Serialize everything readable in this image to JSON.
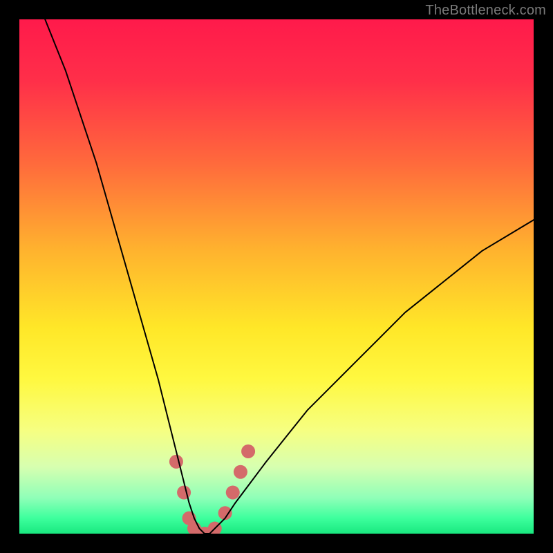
{
  "watermark": "TheBottleneck.com",
  "chart_data": {
    "type": "line",
    "title": "",
    "xlabel": "",
    "ylabel": "",
    "xlim": [
      0,
      100
    ],
    "ylim": [
      0,
      100
    ],
    "grid": false,
    "legend": false,
    "gradient_stops": [
      {
        "offset": 0.0,
        "color": "#ff1a4b"
      },
      {
        "offset": 0.12,
        "color": "#ff2f49"
      },
      {
        "offset": 0.28,
        "color": "#ff6a3c"
      },
      {
        "offset": 0.45,
        "color": "#ffb32e"
      },
      {
        "offset": 0.6,
        "color": "#ffe728"
      },
      {
        "offset": 0.7,
        "color": "#fff840"
      },
      {
        "offset": 0.8,
        "color": "#f6ff82"
      },
      {
        "offset": 0.87,
        "color": "#d7ffb0"
      },
      {
        "offset": 0.93,
        "color": "#90ffb8"
      },
      {
        "offset": 0.97,
        "color": "#3dff9d"
      },
      {
        "offset": 1.0,
        "color": "#19e87f"
      }
    ],
    "series": [
      {
        "name": "bottleneck-curve",
        "stroke": "#000000",
        "stroke_width": 2,
        "x": [
          5,
          7,
          9,
          11,
          13,
          15,
          17,
          19,
          21,
          23,
          25,
          27,
          29,
          30,
          31,
          32,
          33,
          34,
          35,
          36,
          37,
          38,
          40,
          42,
          45,
          48,
          52,
          56,
          60,
          65,
          70,
          75,
          80,
          85,
          90,
          95,
          100
        ],
        "y": [
          100,
          95,
          90,
          84,
          78,
          72,
          65,
          58,
          51,
          44,
          37,
          30,
          22,
          18,
          14,
          10,
          6,
          3,
          1,
          0,
          0,
          1,
          3,
          6,
          10,
          14,
          19,
          24,
          28,
          33,
          38,
          43,
          47,
          51,
          55,
          58,
          61
        ]
      }
    ],
    "markers": {
      "name": "highlight-dots",
      "color": "#d46a6a",
      "radius": 10,
      "points": [
        {
          "x": 30.5,
          "y": 14
        },
        {
          "x": 32.0,
          "y": 8
        },
        {
          "x": 33.0,
          "y": 3
        },
        {
          "x": 34.0,
          "y": 1
        },
        {
          "x": 35.0,
          "y": 0
        },
        {
          "x": 36.0,
          "y": 0
        },
        {
          "x": 37.0,
          "y": 0
        },
        {
          "x": 38.0,
          "y": 1
        },
        {
          "x": 40.0,
          "y": 4
        },
        {
          "x": 41.5,
          "y": 8
        },
        {
          "x": 43.0,
          "y": 12
        },
        {
          "x": 44.5,
          "y": 16
        }
      ]
    }
  }
}
